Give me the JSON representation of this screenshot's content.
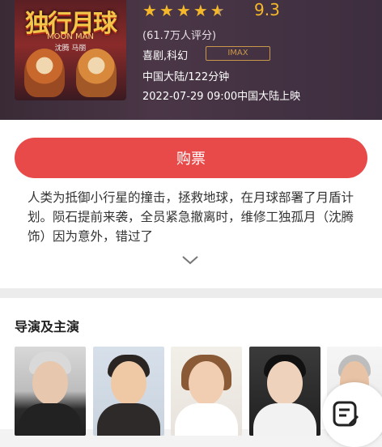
{
  "movie": {
    "poster_title": "独行月球",
    "poster_subtitle": "MOON MAN",
    "poster_cast": "沈腾  马丽",
    "stars": [
      "★",
      "★",
      "★",
      "★",
      "★"
    ],
    "score": "9.3",
    "rating_count": "(61.7万人评分)",
    "genre": "喜剧,科幻",
    "format_badge": "IMAX",
    "country_duration": "中国大陆/122分钟",
    "release": "2022-07-29 09:00中国大陆上映"
  },
  "actions": {
    "buy_label": "购票"
  },
  "synopsis": {
    "text": "人类为抵御小行星的撞击，拯救地球，在月球部署了月盾计划。陨石提前来袭，全员紧急撤离时，维修工独孤月（沈腾 饰）因为意外，错过了"
  },
  "cast_section": {
    "title": "导演及主演"
  },
  "colors": {
    "accent": "#e84a4a",
    "star": "#f5b82a",
    "badge": "#c9984a"
  },
  "icons": {
    "expand": "chevron-down-icon",
    "comment": "edit-note-icon"
  }
}
